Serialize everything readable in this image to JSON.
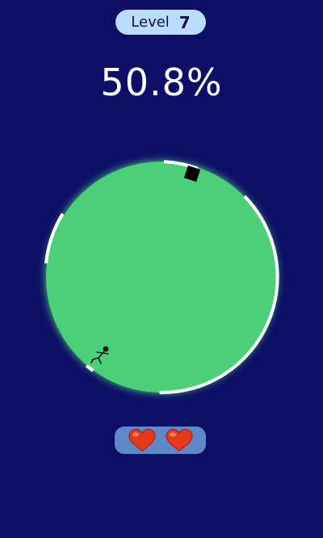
{
  "level": {
    "label": "Level",
    "number": "7"
  },
  "progress_text": "50.8%",
  "colors": {
    "background": "#0d0f66",
    "arena_fill": "#4ccf79",
    "claimed_arc": "#ffffff",
    "enemy_square": "#000000",
    "level_pill": "#b9dcff",
    "lives_pill": "#5f88c9",
    "heart": "#e43a1b"
  },
  "lives": {
    "count": 2,
    "icon": "heart-icon"
  }
}
